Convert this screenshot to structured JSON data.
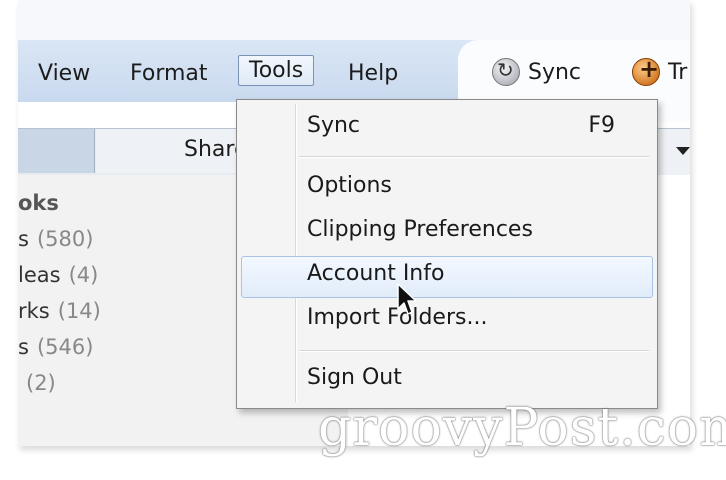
{
  "menubar": {
    "items": [
      {
        "label": "View"
      },
      {
        "label": "Format"
      },
      {
        "label": "Tools"
      },
      {
        "label": "Help"
      }
    ]
  },
  "toolbar": {
    "sync_label": "Sync",
    "trunk_label": "Tr"
  },
  "tabs": {
    "shared_label": "Share"
  },
  "notebooks": {
    "title": "oks",
    "items": [
      {
        "label": "s",
        "count": "(580)"
      },
      {
        "label": "leas",
        "count": "(4)"
      },
      {
        "label": "rks",
        "count": "(14)"
      },
      {
        "label": "s",
        "count": "(546)"
      },
      {
        "label": "",
        "count": "(2)"
      }
    ]
  },
  "tools_menu": {
    "items": [
      {
        "label": "Sync",
        "shortcut": "F9"
      },
      {
        "label": "Options"
      },
      {
        "label": "Clipping Preferences"
      },
      {
        "label": "Account Info"
      },
      {
        "label": "Import Folders..."
      },
      {
        "label": "Sign Out"
      }
    ],
    "hovered": "Account Info"
  },
  "watermark": "groovyPost.com",
  "icons": {
    "sync": "sync-icon",
    "trunk": "trunk-plus-icon",
    "dropdown": "chevron-down-icon",
    "cursor": "mouse-pointer-icon"
  }
}
